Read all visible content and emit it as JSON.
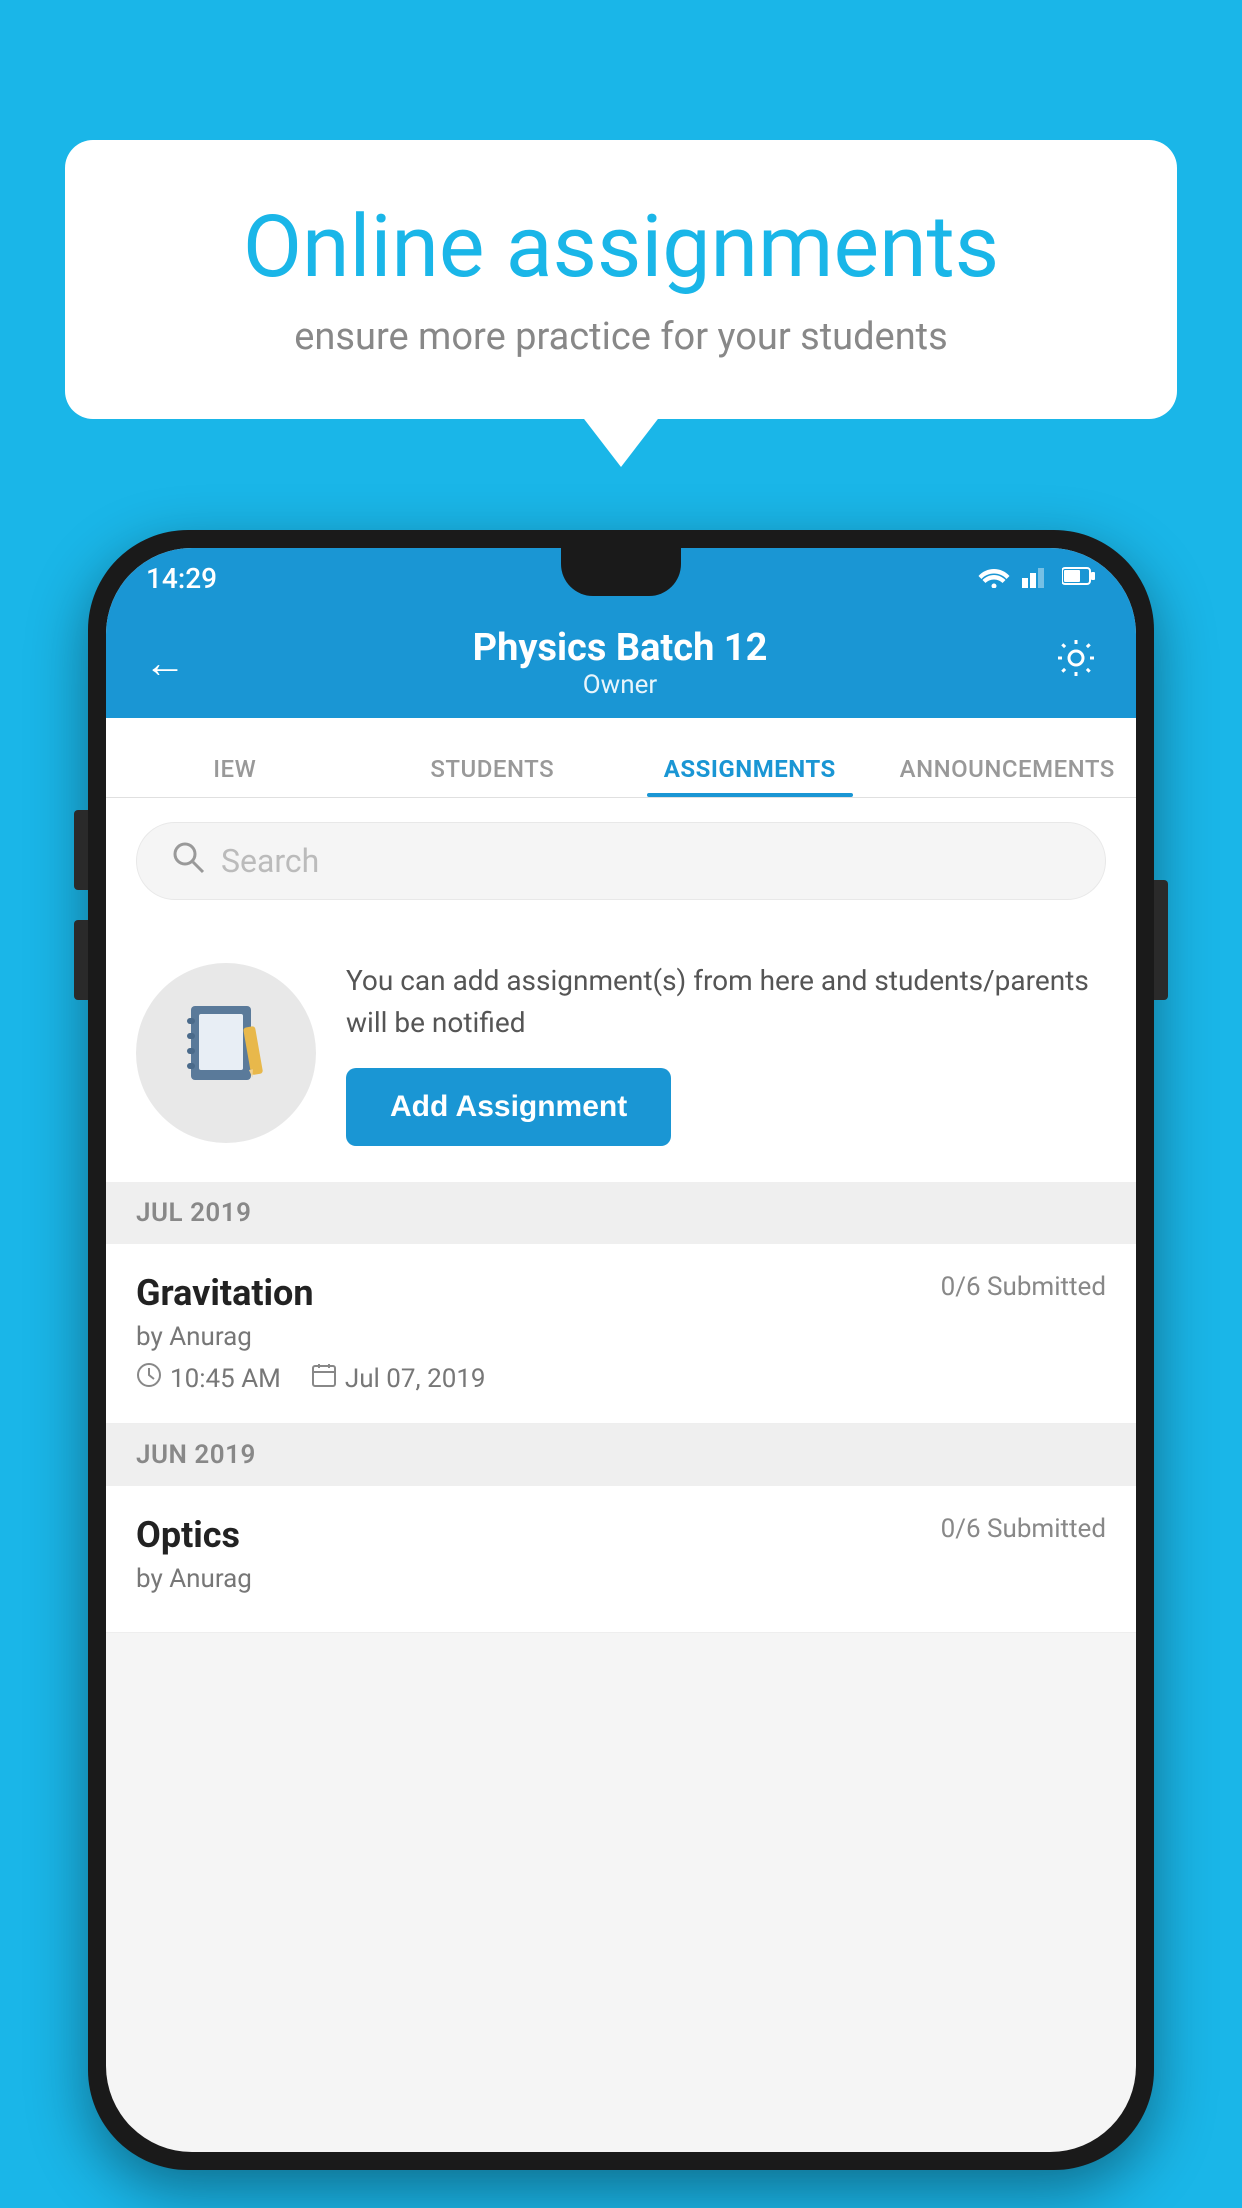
{
  "background_color": "#1ab6e8",
  "speech_bubble": {
    "title": "Online assignments",
    "subtitle": "ensure more practice for your students"
  },
  "phone": {
    "status_bar": {
      "time": "14:29",
      "wifi": "▾",
      "signal": "▲",
      "battery": "▐"
    },
    "header": {
      "title": "Physics Batch 12",
      "subtitle": "Owner",
      "back_label": "←",
      "settings_label": "⚙"
    },
    "tabs": [
      {
        "label": "IEW",
        "active": false
      },
      {
        "label": "STUDENTS",
        "active": false
      },
      {
        "label": "ASSIGNMENTS",
        "active": true
      },
      {
        "label": "ANNOUNCEMENTS",
        "active": false
      }
    ],
    "search": {
      "placeholder": "Search"
    },
    "promo": {
      "description": "You can add assignment(s) from here and students/parents will be notified",
      "button_label": "Add Assignment"
    },
    "sections": [
      {
        "label": "JUL 2019",
        "assignments": [
          {
            "name": "Gravitation",
            "status": "0/6 Submitted",
            "author": "by Anurag",
            "time": "10:45 AM",
            "date": "Jul 07, 2019"
          }
        ]
      },
      {
        "label": "JUN 2019",
        "assignments": [
          {
            "name": "Optics",
            "status": "0/6 Submitted",
            "author": "by Anurag",
            "time": "",
            "date": ""
          }
        ]
      }
    ]
  }
}
